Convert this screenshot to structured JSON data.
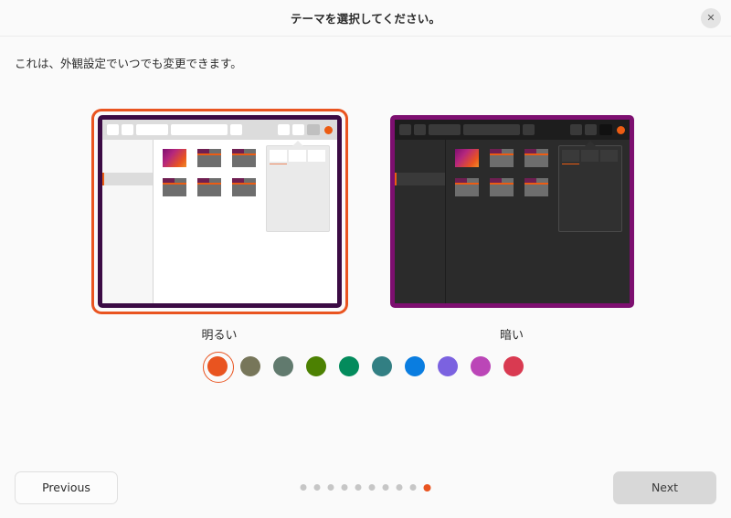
{
  "header": {
    "title": "テーマを選択してください。",
    "close_label": "✕"
  },
  "body": {
    "subtitle": "これは、外観設定でいつでも変更できます。"
  },
  "themes": [
    {
      "id": "light",
      "label": "明るい",
      "selected": true,
      "border_color": "#3b0b44"
    },
    {
      "id": "dark",
      "label": "暗い",
      "selected": false,
      "border_color": "#7d0f70"
    }
  ],
  "accent_colors": [
    {
      "name": "orange",
      "hex": "#e95420",
      "selected": true
    },
    {
      "name": "olive",
      "hex": "#77765a",
      "selected": false
    },
    {
      "name": "sage",
      "hex": "#617a6e",
      "selected": false
    },
    {
      "name": "green",
      "hex": "#4c8102",
      "selected": false
    },
    {
      "name": "emerald",
      "hex": "#038b5c",
      "selected": false
    },
    {
      "name": "teal",
      "hex": "#327f83",
      "selected": false
    },
    {
      "name": "blue",
      "hex": "#0a7de0",
      "selected": false
    },
    {
      "name": "purple",
      "hex": "#7b62e0",
      "selected": false
    },
    {
      "name": "magenta",
      "hex": "#bb46b7",
      "selected": false
    },
    {
      "name": "red",
      "hex": "#d93a51",
      "selected": false
    }
  ],
  "footer": {
    "previous_label": "Previous",
    "next_label": "Next",
    "page_dots": {
      "total": 10,
      "active_index": 9
    }
  },
  "accent_highlight": "#e95420"
}
